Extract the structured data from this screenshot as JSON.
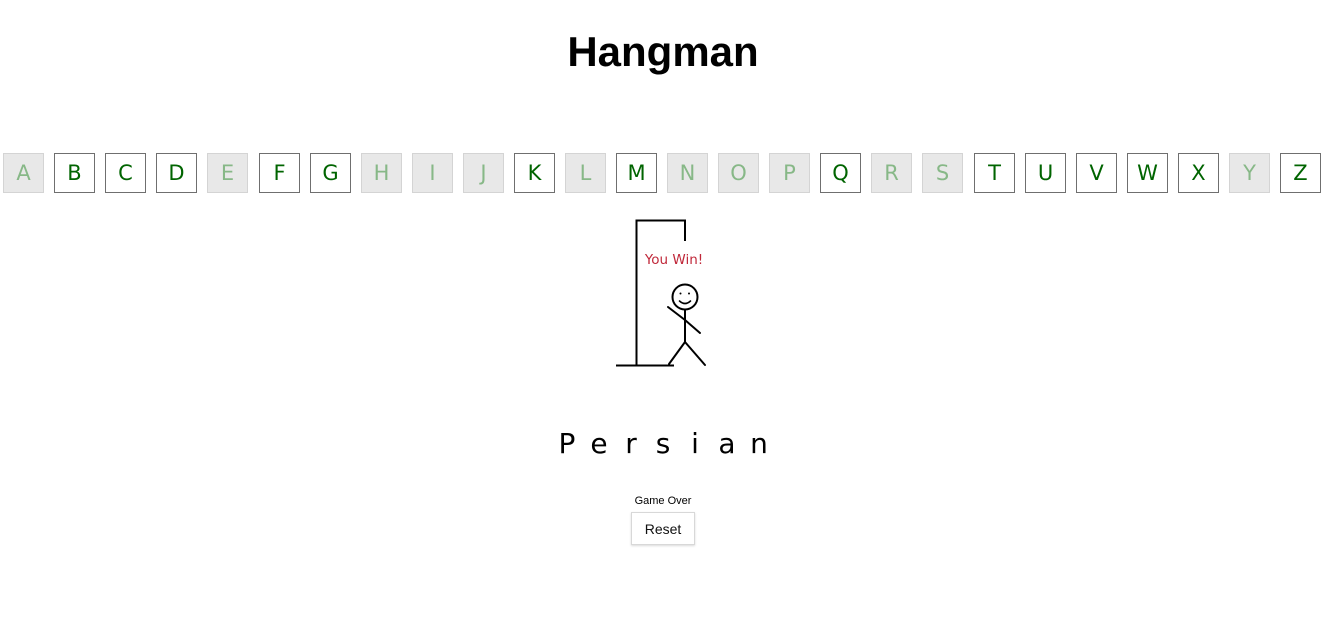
{
  "title": "Hangman",
  "colors": {
    "letter_active": "#006400",
    "letter_used": "#87b887",
    "used_background": "#e8e8e8",
    "win_text": "#c0283a"
  },
  "keyboard": [
    {
      "letter": "A",
      "used": true
    },
    {
      "letter": "B",
      "used": false
    },
    {
      "letter": "C",
      "used": false
    },
    {
      "letter": "D",
      "used": false
    },
    {
      "letter": "E",
      "used": true
    },
    {
      "letter": "F",
      "used": false
    },
    {
      "letter": "G",
      "used": false
    },
    {
      "letter": "H",
      "used": true
    },
    {
      "letter": "I",
      "used": true
    },
    {
      "letter": "J",
      "used": true
    },
    {
      "letter": "K",
      "used": false
    },
    {
      "letter": "L",
      "used": true
    },
    {
      "letter": "M",
      "used": false
    },
    {
      "letter": "N",
      "used": true
    },
    {
      "letter": "O",
      "used": true
    },
    {
      "letter": "P",
      "used": true
    },
    {
      "letter": "Q",
      "used": false
    },
    {
      "letter": "R",
      "used": true
    },
    {
      "letter": "S",
      "used": true
    },
    {
      "letter": "T",
      "used": false
    },
    {
      "letter": "U",
      "used": false
    },
    {
      "letter": "V",
      "used": false
    },
    {
      "letter": "W",
      "used": false
    },
    {
      "letter": "X",
      "used": false
    },
    {
      "letter": "Y",
      "used": true
    },
    {
      "letter": "Z",
      "used": false
    }
  ],
  "drawing": {
    "message": "You Win!",
    "figure": "smiling-stick-figure"
  },
  "word": [
    "P",
    "e",
    "r",
    "s",
    "i",
    "a",
    "n"
  ],
  "status": "Game Over",
  "reset_label": "Reset"
}
